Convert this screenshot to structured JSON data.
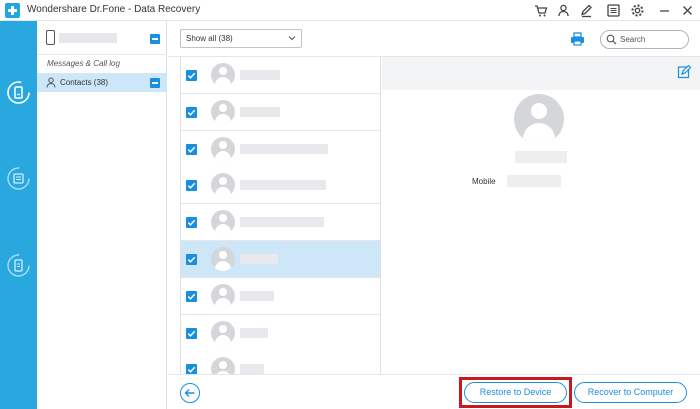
{
  "window": {
    "title": "Wondershare Dr.Fone - Data Recovery",
    "toolbar_icons": [
      "cart-icon",
      "user-icon",
      "feedback-icon",
      "menu-icon",
      "settings-icon",
      "minimize-icon",
      "close-icon"
    ]
  },
  "left_rail": {
    "icons": [
      "recover-from-device-icon",
      "recover-from-itunes-icon",
      "recover-from-icloud-icon"
    ]
  },
  "categories": {
    "section_heading": "Messages & Call log",
    "selected_item": "Contacts (38)"
  },
  "toolbar": {
    "filter_value": "Show all (38)",
    "search_placeholder": "Search"
  },
  "contacts": {
    "rows": [
      {
        "checked": true,
        "selected": false
      },
      {
        "checked": true,
        "selected": false
      },
      {
        "checked": true,
        "selected": false
      },
      {
        "checked": true,
        "selected": false
      },
      {
        "checked": true,
        "selected": false
      },
      {
        "checked": true,
        "selected": true
      },
      {
        "checked": true,
        "selected": false
      },
      {
        "checked": true,
        "selected": false
      },
      {
        "checked": true,
        "selected": false
      }
    ]
  },
  "detail": {
    "mobile_label": "Mobile"
  },
  "footer": {
    "restore_label": "Restore to Device",
    "recover_label": "Recover to Computer"
  },
  "colors": {
    "accent": "#1a8fe0",
    "rail": "#29a8e0",
    "selection": "#cde6f8",
    "highlight": "#c8191f"
  }
}
